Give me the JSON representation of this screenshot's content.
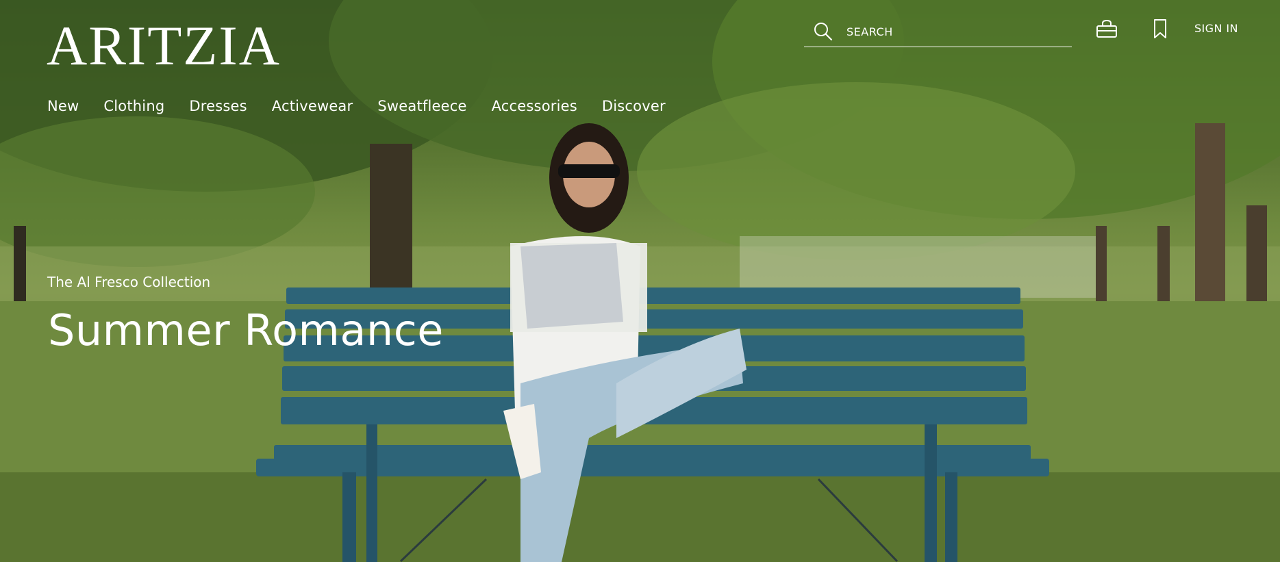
{
  "brand": {
    "logo_text": "ARITZIA"
  },
  "nav": {
    "items": [
      {
        "label": "New"
      },
      {
        "label": "Clothing"
      },
      {
        "label": "Dresses"
      },
      {
        "label": "Activewear"
      },
      {
        "label": "Sweatfleece"
      },
      {
        "label": "Accessories"
      },
      {
        "label": "Discover"
      }
    ]
  },
  "header": {
    "search_placeholder": "SEARCH",
    "sign_in_label": "SIGN IN",
    "icons": [
      "search-icon",
      "shopping-bag-icon",
      "bookmark-icon"
    ]
  },
  "hero": {
    "kicker": "The Al Fresco Collection",
    "headline": "Summer Romance"
  },
  "colors": {
    "text": "#ffffff",
    "bench": "#2d6478",
    "grass": "#6f8a3f",
    "foliage": "#3f5e22"
  }
}
